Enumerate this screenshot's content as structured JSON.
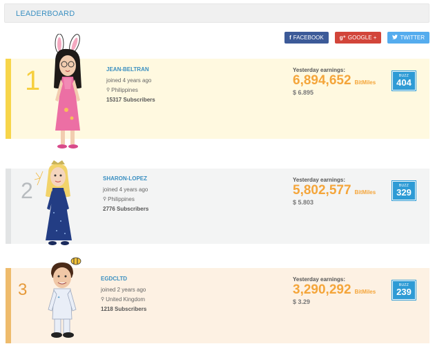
{
  "header": {
    "title": "LEADERBOARD"
  },
  "share": {
    "facebook": {
      "icon": "facebook-icon",
      "label": "FACEBOOK",
      "color": "#3c5a98"
    },
    "google": {
      "icon": "google-plus-icon",
      "label": "GOOGLE +",
      "color": "#d2453a"
    },
    "twitter": {
      "icon": "twitter-icon",
      "label": "TWITTER",
      "color": "#55acee"
    }
  },
  "leaders": [
    {
      "rank": "1",
      "username": "JEAN-BELTRAN",
      "joined": "joined 4 years ago",
      "location": "Philippines",
      "subscribers": "15317 Subscribers",
      "earnings_label": "Yesterday earnings:",
      "earnings": "6,894,652",
      "unit": "BitMiles",
      "usd": "$ 6.895",
      "buzz_label": "BUZZ",
      "buzz": "404"
    },
    {
      "rank": "2",
      "username": "SHARON-LOPEZ",
      "joined": "joined 4 years ago",
      "location": "Philippines",
      "subscribers": "2776 Subscribers",
      "earnings_label": "Yesterday earnings:",
      "earnings": "5,802,577",
      "unit": "BitMiles",
      "usd": "$ 5.803",
      "buzz_label": "BUZZ",
      "buzz": "329"
    },
    {
      "rank": "3",
      "username": "EGDCLTD",
      "joined": "joined 2 years ago",
      "location": "United Kingdom",
      "subscribers": "1218 Subscribers",
      "earnings_label": "Yesterday earnings:",
      "earnings": "3,290,292",
      "unit": "BitMiles",
      "usd": "$ 3.29",
      "buzz_label": "BUZZ",
      "buzz": "239"
    }
  ],
  "colors": {
    "accent": "#3a8fc1",
    "earnings": "#f4a53a",
    "buzz": "#2e9bd5",
    "gold": "#f6cf3e",
    "silver": "#b8bcbf",
    "bronze": "#e69a3a"
  }
}
